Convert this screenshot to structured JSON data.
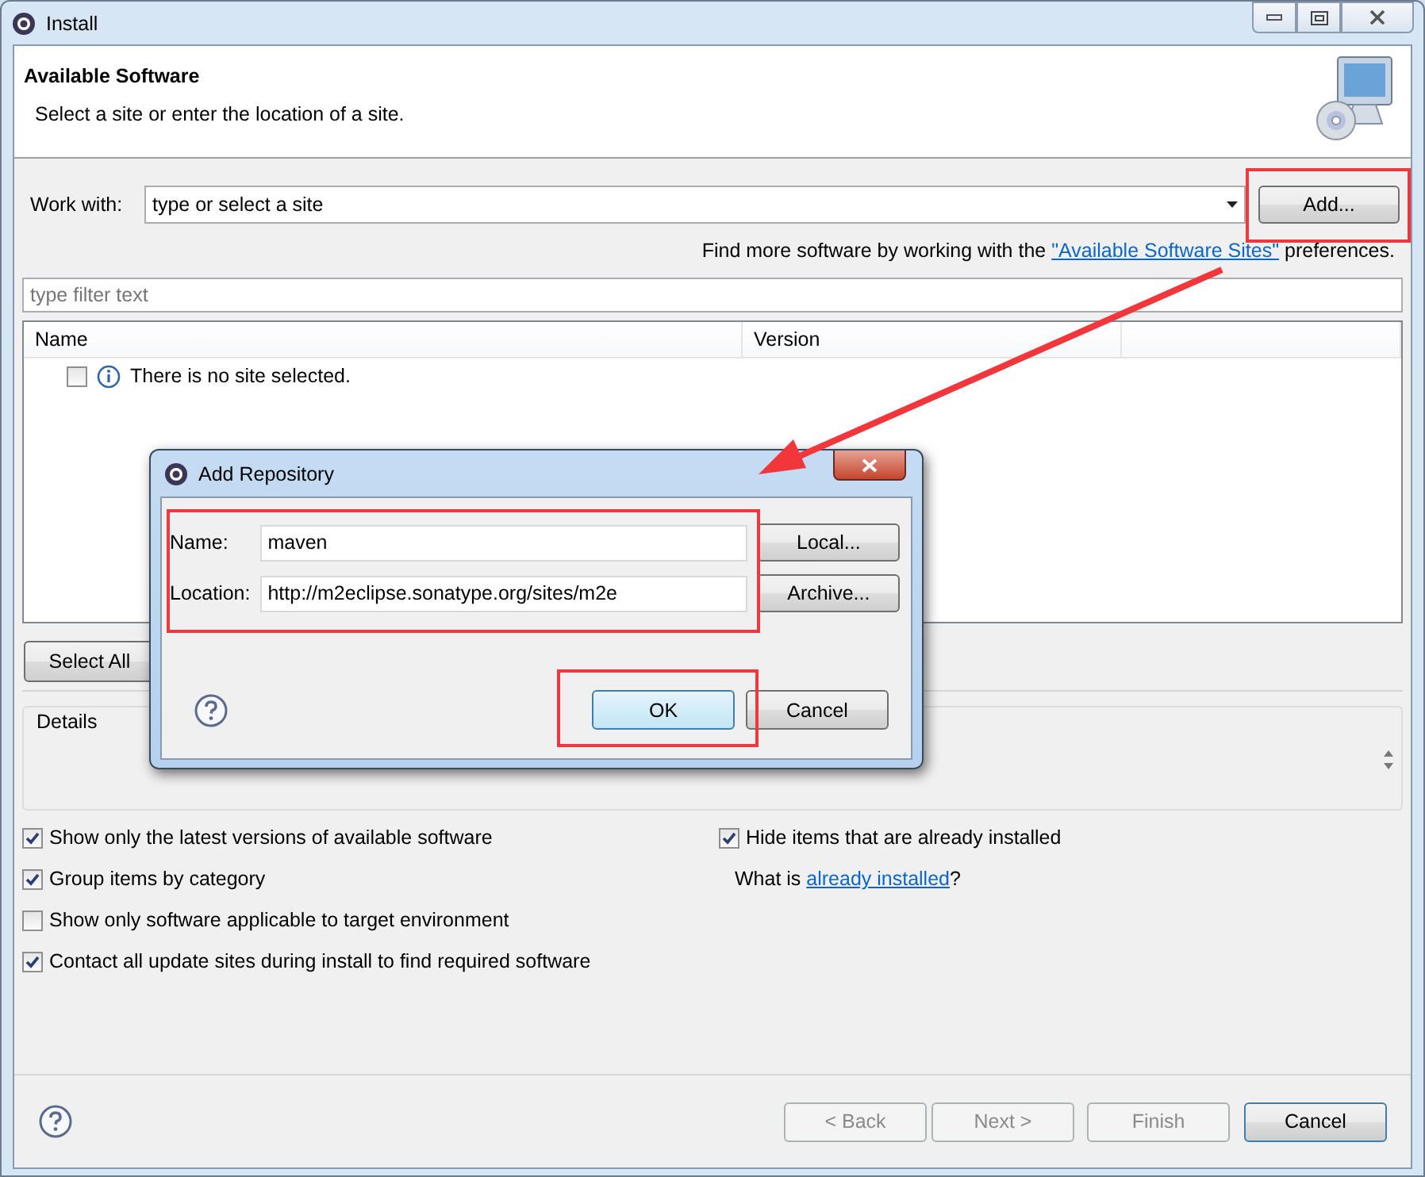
{
  "window": {
    "title": "Install"
  },
  "header": {
    "title": "Available Software",
    "subtitle": "Select a site or enter the location of a site."
  },
  "work_with": {
    "label": "Work with:",
    "value": "type or select a site",
    "add_button": "Add..."
  },
  "find_more": {
    "before": "Find more software by working with the ",
    "link": "\"Available Software Sites\"",
    "after": " preferences."
  },
  "filter": {
    "placeholder": "type filter text"
  },
  "table": {
    "columns": [
      "Name",
      "Version"
    ],
    "rows": [
      {
        "kind": "info",
        "text": "There is no site selected.",
        "checked": false
      }
    ]
  },
  "select_all_button": "Select All",
  "details": {
    "label": "Details"
  },
  "options_left": [
    {
      "label": "Show only the latest versions of available software",
      "checked": true
    },
    {
      "label": "Group items by category",
      "checked": true
    },
    {
      "label": "Show only software applicable to target environment",
      "checked": false
    },
    {
      "label": "Contact all update sites during install to find required software",
      "checked": true
    }
  ],
  "options_right": [
    {
      "label": "Hide items that are already installed",
      "checked": true
    }
  ],
  "installed_hint": {
    "before": "What is ",
    "link": "already installed",
    "after": "?"
  },
  "footer_buttons": [
    {
      "label": "< Back",
      "disabled": true,
      "default": false
    },
    {
      "label": "Next >",
      "disabled": true,
      "default": false
    },
    {
      "label": "Finish",
      "disabled": true,
      "default": false
    },
    {
      "label": "Cancel",
      "disabled": false,
      "default": true
    }
  ],
  "dialog": {
    "title": "Add Repository",
    "fields": [
      {
        "label": "Name:",
        "value": "maven",
        "button": "Local..."
      },
      {
        "label": "Location:",
        "value": "http://m2eclipse.sonatype.org/sites/m2e",
        "button": "Archive..."
      }
    ],
    "buttons": [
      {
        "label": "OK",
        "default": true
      },
      {
        "label": "Cancel",
        "default": false
      }
    ]
  }
}
